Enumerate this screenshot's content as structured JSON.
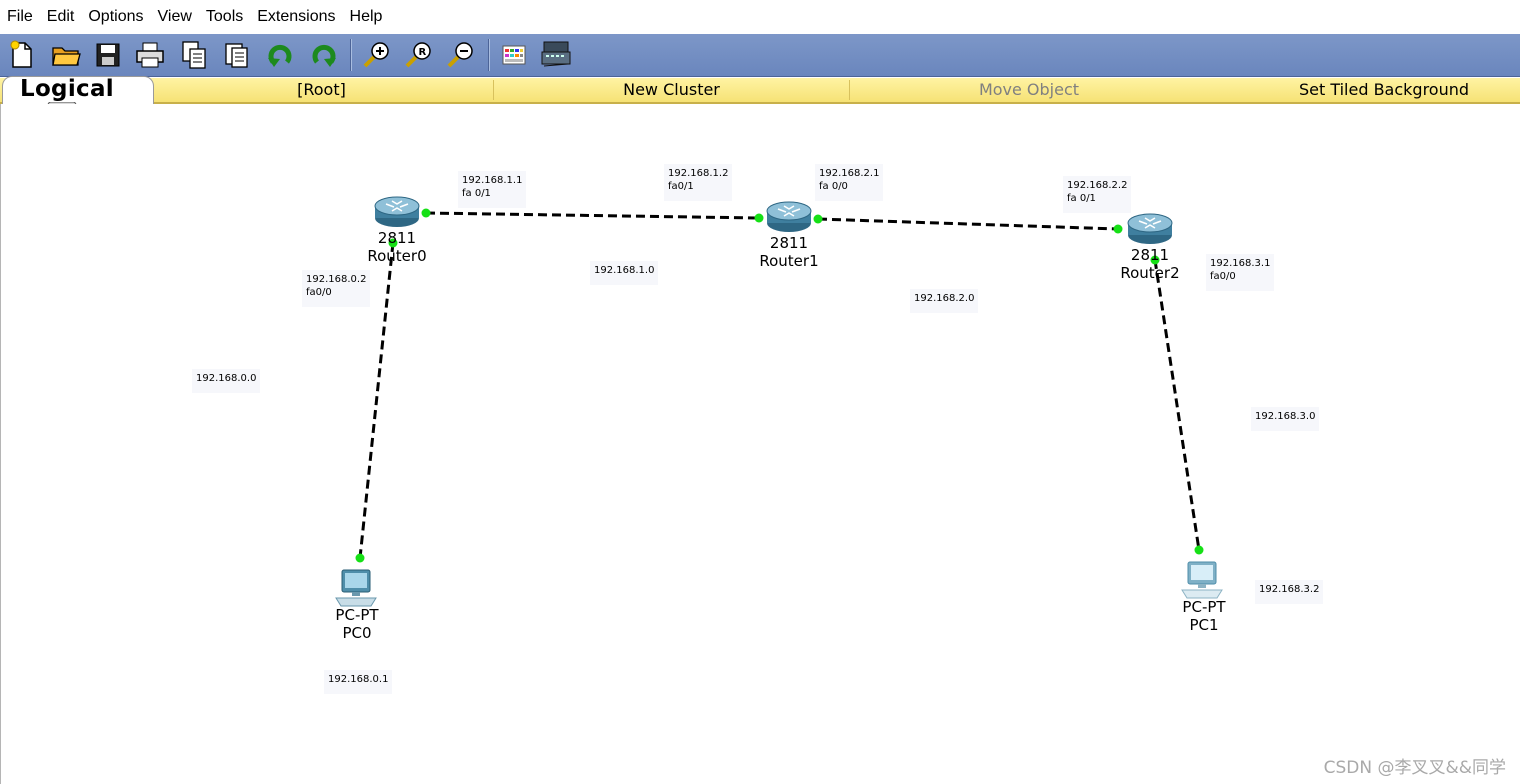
{
  "menubar": {
    "items": [
      "File",
      "Edit",
      "Options",
      "View",
      "Tools",
      "Extensions",
      "Help"
    ]
  },
  "toolbar": {
    "buttons": [
      "new-file-icon",
      "open-folder-icon",
      "save-icon",
      "print-icon",
      "copy-icon",
      "paste-icon",
      "undo-icon",
      "redo-icon",
      "zoom-in-icon",
      "zoom-reset-icon",
      "zoom-out-icon",
      "palette-icon",
      "custom-device-icon"
    ]
  },
  "workspace_bar": {
    "logical_label": "Logical",
    "root_label": "[Root]",
    "new_cluster_label": "New Cluster",
    "move_object_label": "Move Object",
    "background_label": "Set Tiled Background"
  },
  "topology": {
    "devices": [
      {
        "model": "2811",
        "name": "Router0",
        "type": "router"
      },
      {
        "model": "2811",
        "name": "Router1",
        "type": "router"
      },
      {
        "model": "2811",
        "name": "Router2",
        "type": "router"
      },
      {
        "model": "PC-PT",
        "name": "PC0",
        "type": "pc"
      },
      {
        "model": "PC-PT",
        "name": "PC1",
        "type": "pc"
      }
    ],
    "notes": {
      "r0_fa01": "192.168.1.1\nfa 0/1",
      "r1_fa01": "192.168.1.2\nfa0/1",
      "r1_fa00": "192.168.2.1\nfa 0/0",
      "r2_fa01": "192.168.2.2\nfa 0/1",
      "r0_fa00": "192.168.0.2\nfa0/0",
      "r2_fa00": "192.168.3.1\nfa0/0",
      "net_1": "192.168.1.0",
      "net_2": "192.168.2.0",
      "net_0": "192.168.0.0",
      "net_3": "192.168.3.0",
      "pc0_ip": "192.168.0.1",
      "pc1_ip": "192.168.3.2"
    },
    "colors": {
      "link": "#000000",
      "port_up": "#16e016",
      "router_body": "#3f7f9f"
    }
  },
  "watermark": "CSDN @李叉叉&&同学"
}
